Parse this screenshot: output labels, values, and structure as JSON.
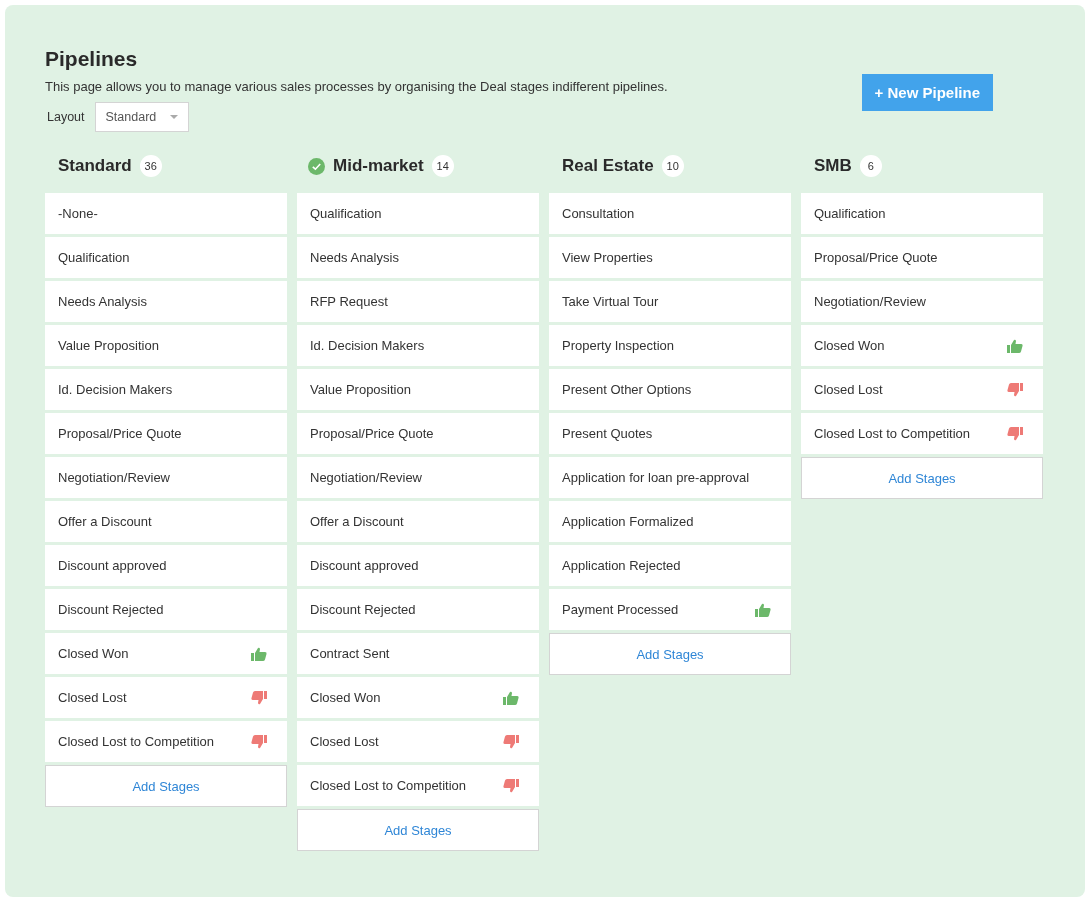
{
  "page": {
    "title": "Pipelines",
    "description": "This page allows you to manage various sales processes by organising the Deal stages indifferent pipelines.",
    "new_button": "+ New Pipeline"
  },
  "layout": {
    "label": "Layout",
    "value": "Standard"
  },
  "pipelines": [
    {
      "name": "Standard",
      "count": "36",
      "default": false,
      "add_button": "Add Stages",
      "stages": [
        {
          "name": "-None-",
          "kind": "open"
        },
        {
          "name": "Qualification",
          "kind": "open"
        },
        {
          "name": "Needs Analysis",
          "kind": "open"
        },
        {
          "name": "Value Proposition",
          "kind": "open"
        },
        {
          "name": "Id. Decision Makers",
          "kind": "open"
        },
        {
          "name": "Proposal/Price Quote",
          "kind": "open"
        },
        {
          "name": "Negotiation/Review",
          "kind": "open"
        },
        {
          "name": "Offer a Discount",
          "kind": "open"
        },
        {
          "name": "Discount approved",
          "kind": "open"
        },
        {
          "name": "Discount Rejected",
          "kind": "open"
        },
        {
          "name": "Closed Won",
          "kind": "won"
        },
        {
          "name": "Closed Lost",
          "kind": "lost"
        },
        {
          "name": "Closed Lost to Competition",
          "kind": "lost"
        }
      ]
    },
    {
      "name": "Mid-market",
      "count": "14",
      "default": true,
      "add_button": "Add Stages",
      "stages": [
        {
          "name": "Qualification",
          "kind": "open"
        },
        {
          "name": "Needs Analysis",
          "kind": "open"
        },
        {
          "name": "RFP Request",
          "kind": "open"
        },
        {
          "name": "Id. Decision Makers",
          "kind": "open"
        },
        {
          "name": "Value Proposition",
          "kind": "open"
        },
        {
          "name": "Proposal/Price Quote",
          "kind": "open"
        },
        {
          "name": "Negotiation/Review",
          "kind": "open"
        },
        {
          "name": "Offer a Discount",
          "kind": "open"
        },
        {
          "name": "Discount approved",
          "kind": "open"
        },
        {
          "name": "Discount Rejected",
          "kind": "open"
        },
        {
          "name": "Contract Sent",
          "kind": "open"
        },
        {
          "name": "Closed Won",
          "kind": "won"
        },
        {
          "name": "Closed Lost",
          "kind": "lost"
        },
        {
          "name": "Closed Lost to Competition",
          "kind": "lost"
        }
      ]
    },
    {
      "name": "Real Estate",
      "count": "10",
      "default": false,
      "add_button": "Add Stages",
      "stages": [
        {
          "name": "Consultation",
          "kind": "open"
        },
        {
          "name": "View Properties",
          "kind": "open"
        },
        {
          "name": "Take Virtual Tour",
          "kind": "open"
        },
        {
          "name": "Property Inspection",
          "kind": "open"
        },
        {
          "name": "Present Other Options",
          "kind": "open"
        },
        {
          "name": "Present Quotes",
          "kind": "open"
        },
        {
          "name": "Application for loan pre-approval",
          "kind": "open"
        },
        {
          "name": "Application Formalized",
          "kind": "open"
        },
        {
          "name": "Application Rejected",
          "kind": "open"
        },
        {
          "name": "Payment Processed",
          "kind": "won"
        }
      ]
    },
    {
      "name": "SMB",
      "count": "6",
      "default": false,
      "add_button": "Add Stages",
      "stages": [
        {
          "name": "Qualification",
          "kind": "open"
        },
        {
          "name": "Proposal/Price Quote",
          "kind": "open"
        },
        {
          "name": "Negotiation/Review",
          "kind": "open"
        },
        {
          "name": "Closed Won",
          "kind": "won"
        },
        {
          "name": "Closed Lost",
          "kind": "lost"
        },
        {
          "name": "Closed Lost to Competition",
          "kind": "lost"
        }
      ]
    }
  ]
}
